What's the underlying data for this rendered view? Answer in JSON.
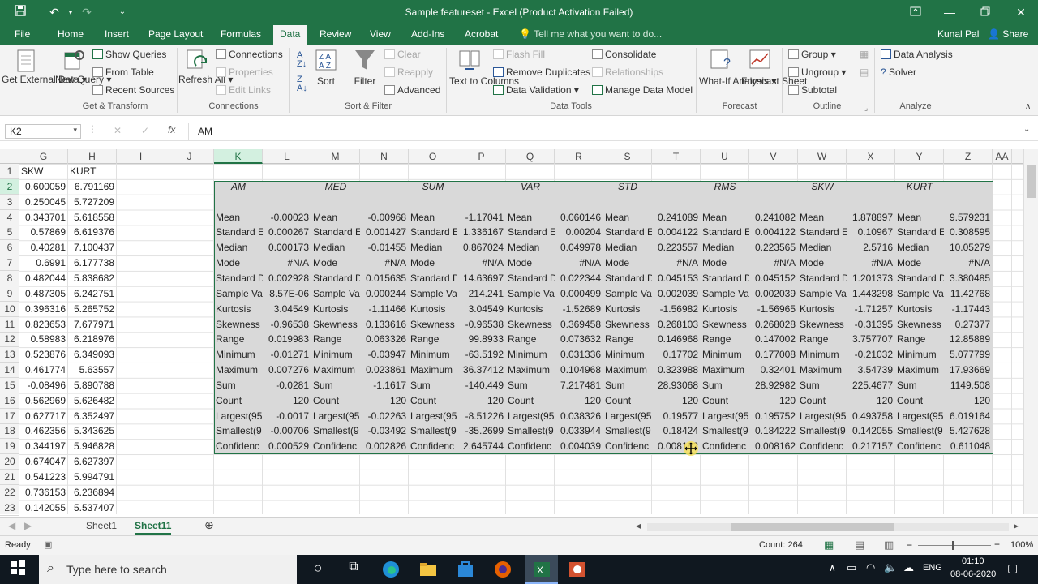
{
  "window": {
    "title": "Sample featureset - Excel (Product Activation Failed)",
    "user": "Kunal Pal",
    "share": "Share"
  },
  "tabs": [
    "File",
    "Home",
    "Insert",
    "Page Layout",
    "Formulas",
    "Data",
    "Review",
    "View",
    "Add-Ins",
    "Acrobat"
  ],
  "active_tab": "Data",
  "tell_me": "Tell me what you want to do...",
  "ribbon": {
    "get_external": "Get External Data",
    "new_query": "New Query",
    "show_queries": "Show Queries",
    "from_table": "From Table",
    "recent_sources": "Recent Sources",
    "refresh_all": "Refresh All",
    "connections": "Connections",
    "properties": "Properties",
    "edit_links": "Edit Links",
    "sort": "Sort",
    "filter": "Filter",
    "clear": "Clear",
    "reapply": "Reapply",
    "advanced": "Advanced",
    "text_to_columns": "Text to Columns",
    "flash_fill": "Flash Fill",
    "remove_duplicates": "Remove Duplicates",
    "data_validation": "Data Validation",
    "consolidate": "Consolidate",
    "relationships": "Relationships",
    "manage_data_model": "Manage Data Model",
    "what_if": "What-If Analysis",
    "forecast_sheet": "Forecast Sheet",
    "group": "Group",
    "ungroup": "Ungroup",
    "subtotal": "Subtotal",
    "data_analysis": "Data Analysis",
    "solver": "Solver",
    "groups": [
      "Get & Transform",
      "Connections",
      "Sort & Filter",
      "Data Tools",
      "Forecast",
      "Outline",
      "Analyze"
    ]
  },
  "formula_bar": {
    "name_box": "K2",
    "content": "AM"
  },
  "columns": [
    "G",
    "H",
    "I",
    "J",
    "K",
    "L",
    "M",
    "N",
    "O",
    "P",
    "Q",
    "R",
    "S",
    "T",
    "U",
    "V",
    "W",
    "X",
    "Y",
    "Z",
    "AA"
  ],
  "rows": [
    "1",
    "2",
    "3",
    "4",
    "5",
    "6",
    "7",
    "8",
    "9",
    "10",
    "11",
    "12",
    "13",
    "14",
    "15",
    "16",
    "17",
    "18",
    "19",
    "20",
    "21",
    "22",
    "23"
  ],
  "gh_header": [
    "SKW",
    "KURT"
  ],
  "gh_values": [
    [
      "0.600059",
      "6.791169"
    ],
    [
      "0.250045",
      "5.727209"
    ],
    [
      "0.343701",
      "5.618558"
    ],
    [
      "0.57869",
      "6.619376"
    ],
    [
      "0.40281",
      "7.100437"
    ],
    [
      "0.6991",
      "6.177738"
    ],
    [
      "0.482044",
      "5.838682"
    ],
    [
      "0.487305",
      "6.242751"
    ],
    [
      "0.396316",
      "5.265752"
    ],
    [
      "0.823653",
      "7.677971"
    ],
    [
      "0.58983",
      "6.218976"
    ],
    [
      "0.523876",
      "6.349093"
    ],
    [
      "0.461774",
      "5.63557"
    ],
    [
      "-0.08496",
      "5.890788"
    ],
    [
      "0.562969",
      "5.626482"
    ],
    [
      "0.627717",
      "6.352497"
    ],
    [
      "0.462356",
      "5.343625"
    ],
    [
      "0.344197",
      "5.946828"
    ],
    [
      "0.674047",
      "6.627397"
    ],
    [
      "0.541223",
      "5.994791"
    ],
    [
      "0.736153",
      "6.236894"
    ],
    [
      "0.142055",
      "5.537407"
    ]
  ],
  "stat_headers": [
    "AM",
    "MED",
    "SUM",
    "VAR",
    "STD",
    "RMS",
    "SKW",
    "KURT"
  ],
  "stat_labels": [
    "Mean",
    "Standard E",
    "Median",
    "Mode",
    "Standard D",
    "Sample Va",
    "Kurtosis",
    "Skewness",
    "Range",
    "Minimum",
    "Maximum",
    "Sum",
    "Count",
    "Largest(95",
    "Smallest(9",
    "Confidenc"
  ],
  "stat_values": [
    [
      "-0.00023",
      "-0.00968",
      "-1.17041",
      "0.060146",
      "0.241089",
      "0.241082",
      "1.878897",
      "9.579231"
    ],
    [
      "0.000267",
      "0.001427",
      "1.336167",
      "0.00204",
      "0.004122",
      "0.004122",
      "0.10967",
      "0.308595"
    ],
    [
      "0.000173",
      "-0.01455",
      "0.867024",
      "0.049978",
      "0.223557",
      "0.223565",
      "2.5716",
      "10.05279"
    ],
    [
      "#N/A",
      "#N/A",
      "#N/A",
      "#N/A",
      "#N/A",
      "#N/A",
      "#N/A",
      "#N/A"
    ],
    [
      "0.002928",
      "0.015635",
      "14.63697",
      "0.022344",
      "0.045153",
      "0.045152",
      "1.201373",
      "3.380485"
    ],
    [
      "8.57E-06",
      "0.000244",
      "214.241",
      "0.000499",
      "0.002039",
      "0.002039",
      "1.443298",
      "11.42768"
    ],
    [
      "3.04549",
      "-1.11466",
      "3.04549",
      "-1.52689",
      "-1.56982",
      "-1.56965",
      "-1.71257",
      "-1.17443"
    ],
    [
      "-0.96538",
      "0.133616",
      "-0.96538",
      "0.369458",
      "0.268103",
      "0.268028",
      "-0.31395",
      "0.27377"
    ],
    [
      "0.019983",
      "0.063326",
      "99.8933",
      "0.073632",
      "0.146968",
      "0.147002",
      "3.757707",
      "12.85889"
    ],
    [
      "-0.01271",
      "-0.03947",
      "-63.5192",
      "0.031336",
      "0.17702",
      "0.177008",
      "-0.21032",
      "5.077799"
    ],
    [
      "0.007276",
      "0.023861",
      "36.37412",
      "0.104968",
      "0.323988",
      "0.32401",
      "3.54739",
      "17.93669"
    ],
    [
      "-0.0281",
      "-1.1617",
      "-140.449",
      "7.217481",
      "28.93068",
      "28.92982",
      "225.4677",
      "1149.508"
    ],
    [
      "120",
      "120",
      "120",
      "120",
      "120",
      "120",
      "120",
      "120"
    ],
    [
      "-0.0017",
      "-0.02263",
      "-8.51226",
      "0.038326",
      "0.19577",
      "0.195752",
      "0.493758",
      "6.019164"
    ],
    [
      "-0.00706",
      "-0.03492",
      "-35.2699",
      "0.033944",
      "0.18424",
      "0.184222",
      "0.142055",
      "5.427628"
    ],
    [
      "0.000529",
      "0.002826",
      "2.645744",
      "0.004039",
      "0.008162",
      "0.008162",
      "0.217157",
      "0.611048"
    ]
  ],
  "sheets": [
    "Sheet1",
    "Sheet11"
  ],
  "active_sheet": "Sheet11",
  "status": {
    "ready": "Ready",
    "count": "Count: 264",
    "zoom": "100%"
  },
  "taskbar": {
    "search": "Type here to search",
    "lang": "ENG",
    "time": "01:10",
    "date": "08-06-2020"
  },
  "colors": {
    "excel_green": "#217346",
    "selection_fill": "#d9d9d9",
    "header_sel": "#d3f0e0"
  }
}
